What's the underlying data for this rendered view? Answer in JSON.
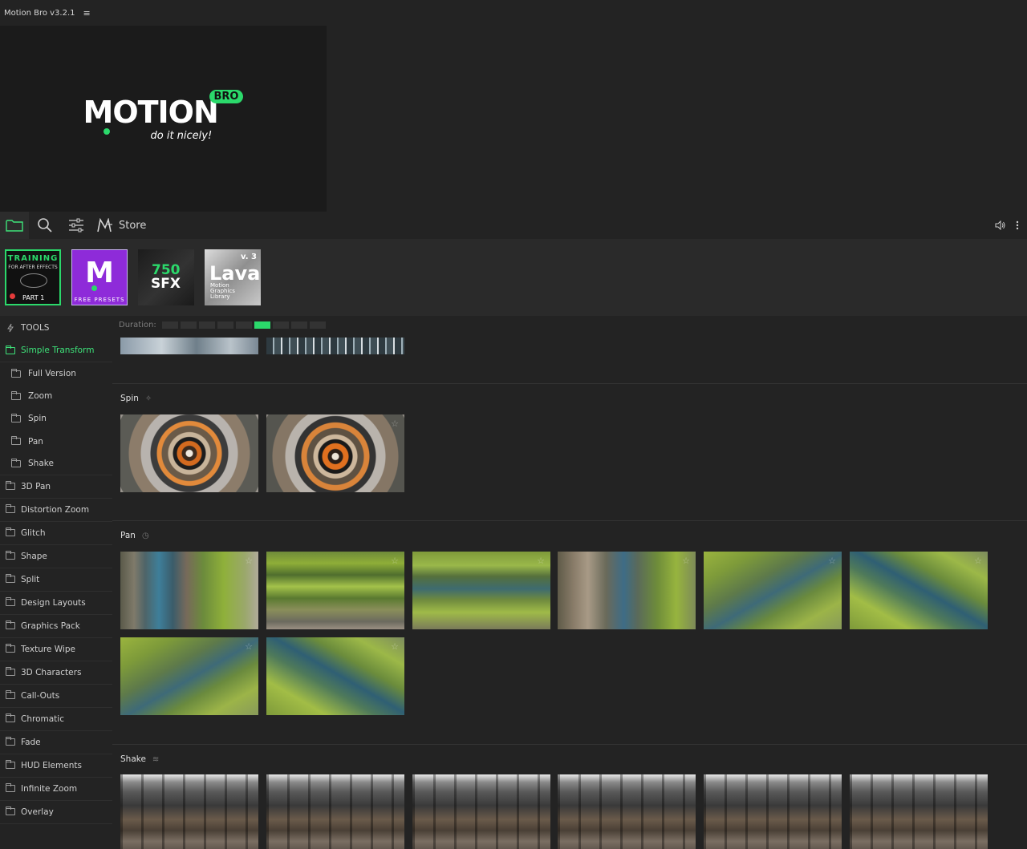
{
  "app": {
    "title": "Motion Bro v3.2.1",
    "menu_glyph": "≡"
  },
  "banner": {
    "logo_text": "MOTION",
    "logo_badge": "BRO",
    "tagline": "do it nicely!"
  },
  "toolbar": {
    "store_label": "Store",
    "icons": [
      "folder-icon",
      "search-icon",
      "sliders-icon",
      "store-logo-icon",
      "volume-icon",
      "more-vertical-icon"
    ]
  },
  "promos": [
    {
      "name": "training",
      "line1": "TRAINING",
      "line2": "FOR AFTER EFFECTS",
      "line3": "PART 1"
    },
    {
      "name": "free-presets",
      "glyph": "M",
      "label": "FREE PRESETS"
    },
    {
      "name": "sfx",
      "line1": "750",
      "line2": "SFX"
    },
    {
      "name": "lava",
      "version": "v. 3",
      "title": "Lava",
      "sub1": "Motion",
      "sub2": "Graphics",
      "sub3": "Library"
    }
  ],
  "sidebar": {
    "tools_label": "TOOLS",
    "items": [
      {
        "label": "Simple Transform",
        "active": true
      },
      {
        "label": "Full Version",
        "sub": true
      },
      {
        "label": "Zoom",
        "sub": true
      },
      {
        "label": "Spin",
        "sub": true
      },
      {
        "label": "Pan",
        "sub": true
      },
      {
        "label": "Shake",
        "sub": true
      },
      {
        "label": "3D Pan"
      },
      {
        "label": "Distortion Zoom"
      },
      {
        "label": "Glitch"
      },
      {
        "label": "Shape"
      },
      {
        "label": "Split"
      },
      {
        "label": "Design Layouts"
      },
      {
        "label": "Graphics Pack"
      },
      {
        "label": "Texture Wipe"
      },
      {
        "label": "3D Characters"
      },
      {
        "label": "Call-Outs"
      },
      {
        "label": "Chromatic"
      },
      {
        "label": "Fade"
      },
      {
        "label": "HUD Elements"
      },
      {
        "label": "Infinite Zoom"
      },
      {
        "label": "Overlay"
      }
    ]
  },
  "duration": {
    "label": "Duration:",
    "segments": 9,
    "active_index": 5
  },
  "sections": {
    "spin": {
      "title": "Spin",
      "icon": "✧"
    },
    "pan": {
      "title": "Pan",
      "icon": "◷"
    },
    "shake": {
      "title": "Shake",
      "icon": "≋"
    }
  },
  "colors": {
    "accent": "#2bd96b",
    "background": "#232323",
    "panel": "#2a2a2a"
  }
}
